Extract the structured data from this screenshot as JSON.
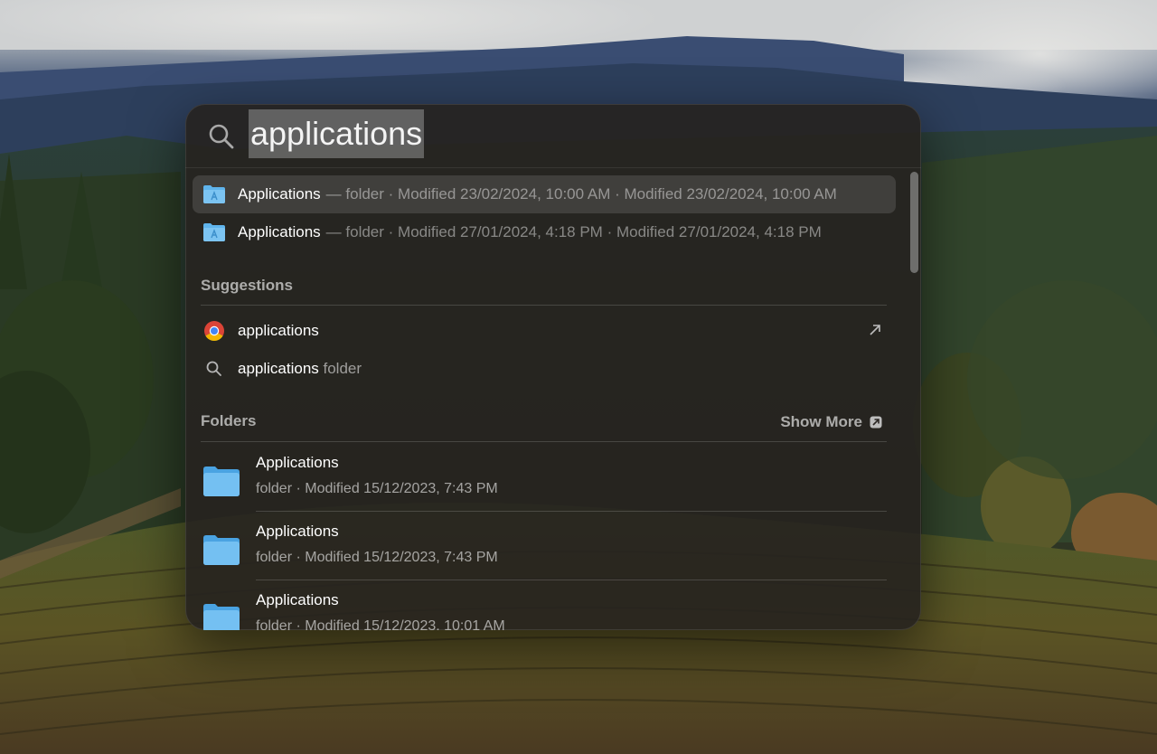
{
  "search": {
    "query": "applications"
  },
  "top_hits": [
    {
      "name": "Applications",
      "meta": "— folder · Modified 23/02/2024, 10:00 AM · Modified 23/02/2024, 10:00 AM",
      "selected": true
    },
    {
      "name": "Applications",
      "meta": "— folder · Modified 27/01/2024, 4:18 PM · Modified 27/01/2024, 4:18 PM",
      "selected": false
    }
  ],
  "suggestions": {
    "title": "Suggestions",
    "items": [
      {
        "text": "applications",
        "suffix": "",
        "icon": "chrome-icon"
      },
      {
        "text": "applications",
        "suffix": " folder",
        "icon": "search-icon"
      }
    ]
  },
  "folders": {
    "title": "Folders",
    "show_more": "Show More",
    "items": [
      {
        "name": "Applications",
        "meta": "folder · Modified 15/12/2023, 7:43 PM"
      },
      {
        "name": "Applications",
        "meta": "folder · Modified 15/12/2023, 7:43 PM"
      },
      {
        "name": "Applications",
        "meta": "folder · Modified 15/12/2023, 10:01 AM"
      }
    ]
  },
  "colors": {
    "folder_blue": "#5fb4ec",
    "panel_bg": "#26221f"
  }
}
